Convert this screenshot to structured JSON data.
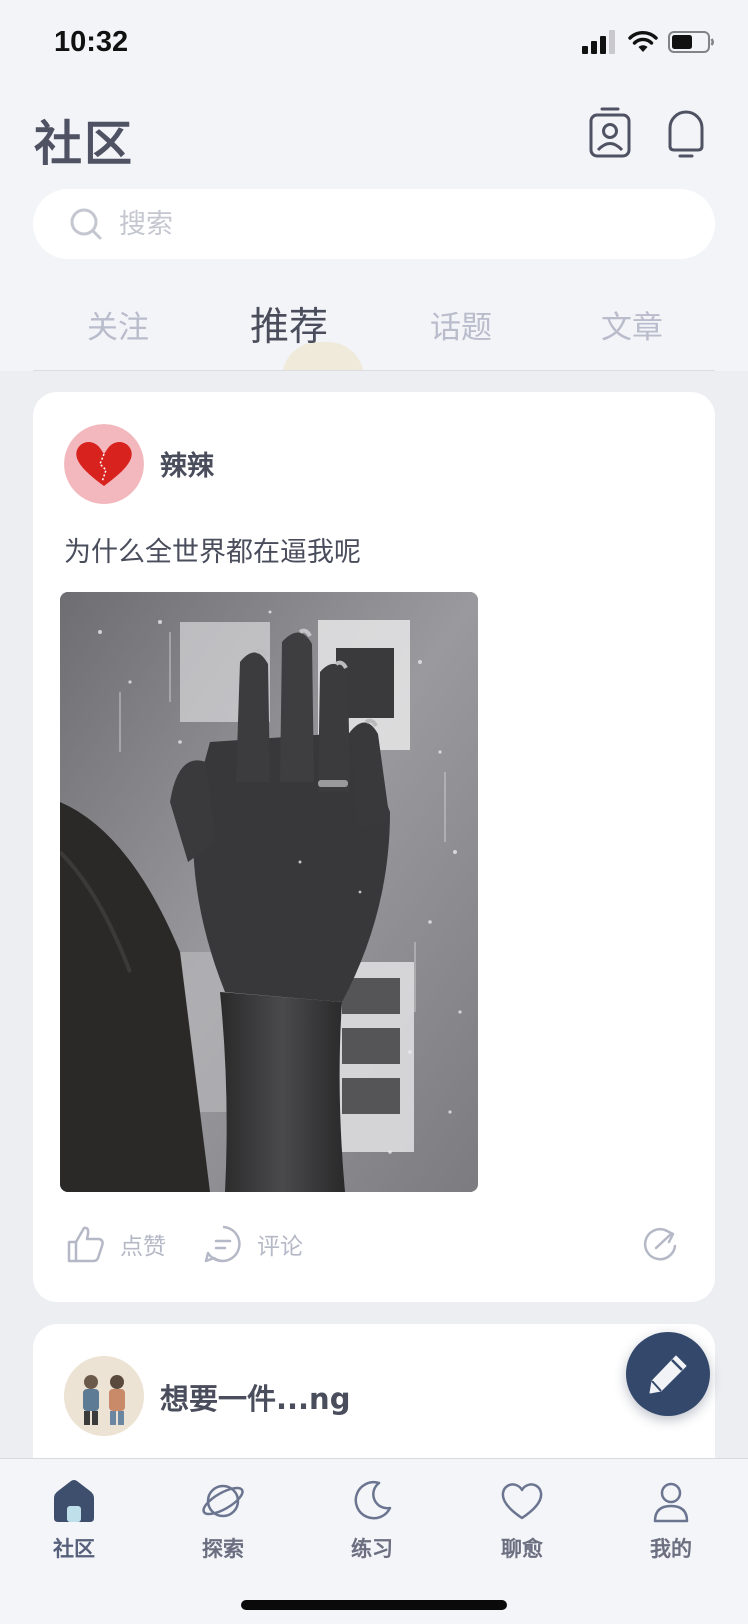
{
  "status_bar": {
    "time": "10:32"
  },
  "header": {
    "title": "社区"
  },
  "search": {
    "placeholder": "搜索"
  },
  "tabs": [
    {
      "label": "关注",
      "active": false
    },
    {
      "label": "推荐",
      "active": true
    },
    {
      "label": "话题",
      "active": false
    },
    {
      "label": "文章",
      "active": false
    }
  ],
  "posts": [
    {
      "username": "辣辣",
      "text": "为什么全世界都在逼我呢",
      "actions": {
        "like": "点赞",
        "comment": "评论"
      }
    },
    {
      "username": "想要一件...ng"
    }
  ],
  "bottom_nav": [
    {
      "label": "社区",
      "icon": "home-icon",
      "active": true
    },
    {
      "label": "探索",
      "icon": "planet-icon",
      "active": false
    },
    {
      "label": "练习",
      "icon": "moon-icon",
      "active": false
    },
    {
      "label": "聊愈",
      "icon": "heart-icon",
      "active": false
    },
    {
      "label": "我的",
      "icon": "user-icon",
      "active": false
    }
  ],
  "colors": {
    "accent": "#34486b",
    "background": "#f3f4f8",
    "text": "#4a4d5c",
    "muted": "#b9bccb"
  }
}
